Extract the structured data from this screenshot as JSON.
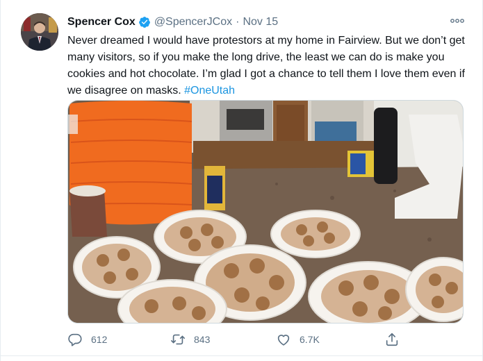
{
  "tweet": {
    "author_name": "Spencer Cox",
    "handle": "@SpencerJCox",
    "separator": "·",
    "date": "Nov 15",
    "text": "Never dreamed I would have protestors at my home in Fairview. But we don’t get many visitors, so if you make the long drive, the least we can do is make you cookies and hot chocolate. I’m glad I got a chance to tell them I love them even if we disagree on masks.",
    "hashtag": "#OneUtah"
  },
  "actions": {
    "replies": "612",
    "retweets": "843",
    "likes": "6.7K"
  },
  "icons": {
    "avatar": "avatar",
    "verified": "verified-badge-icon",
    "more": "more-options-icon",
    "reply": "reply-icon",
    "retweet": "retweet-icon",
    "like": "heart-icon",
    "share": "share-icon"
  },
  "colors": {
    "verified": "#1da1f2",
    "link": "#1b95e0",
    "secondary_text": "#5b7083",
    "primary_text": "#0f1419"
  }
}
